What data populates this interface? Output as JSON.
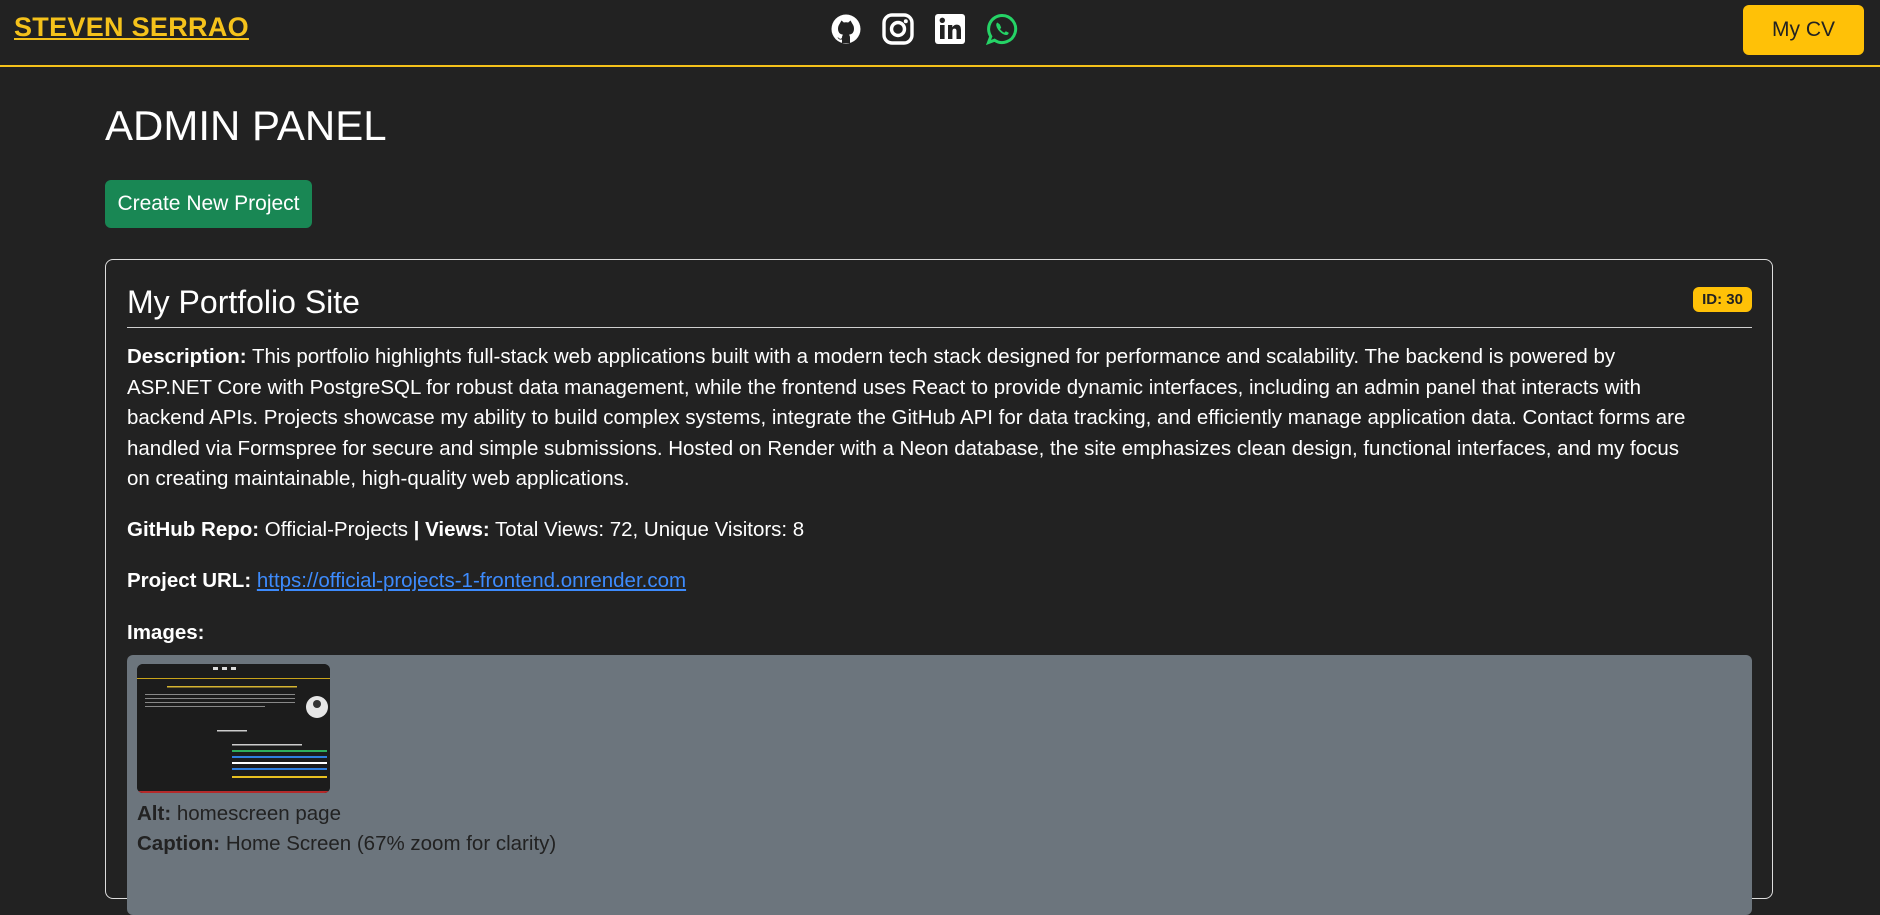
{
  "navbar": {
    "brand": "STEVEN SERRAO",
    "cv_button": "My CV",
    "social_icons": [
      "github-icon",
      "instagram-icon",
      "linkedin-icon",
      "whatsapp-icon"
    ],
    "colors": {
      "accent": "#f5c21b",
      "whatsapp": "#25d366"
    }
  },
  "page": {
    "title": "ADMIN PANEL",
    "create_button": "Create New Project"
  },
  "project": {
    "title": "My Portfolio Site",
    "id_badge": "ID: 30",
    "description_label": "Description:",
    "description": "This portfolio highlights full-stack web applications built with a modern tech stack designed for performance and scalability. The backend is powered by ASP.NET Core with PostgreSQL for robust data management, while the frontend uses React to provide dynamic interfaces, including an admin panel that interacts with backend APIs. Projects showcase my ability to build complex systems, integrate the GitHub API for data tracking, and efficiently manage application data. Contact forms are handled via Formspree for secure and simple submissions. Hosted on Render with a Neon database, the site emphasizes clean design, functional interfaces, and my focus on creating maintainable, high-quality web applications.",
    "repo_label": "GitHub Repo:",
    "repo": "Official-Projects",
    "separator": "|",
    "views_label": "Views:",
    "views": "Total Views: 72, Unique Visitors: 8",
    "url_label": "Project URL:",
    "url": "https://official-projects-1-frontend.onrender.com",
    "images_label": "Images:",
    "image": {
      "alt_label": "Alt:",
      "alt": "homescreen page",
      "caption_label": "Caption:",
      "caption": "Home Screen (67% zoom for clarity)"
    }
  }
}
